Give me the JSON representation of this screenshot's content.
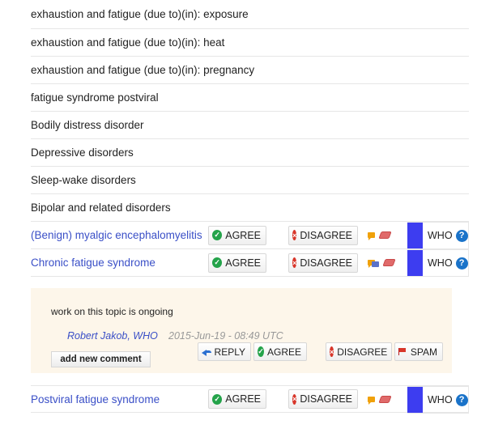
{
  "items": [
    {
      "label": "exhaustion and fatigue (due to)(in): exposure"
    },
    {
      "label": "exhaustion and fatigue (due to)(in): heat"
    },
    {
      "label": "exhaustion and fatigue (due to)(in): pregnancy"
    },
    {
      "label": "fatigue syndrome postviral"
    },
    {
      "label": "Bodily distress disorder"
    },
    {
      "label": "Depressive disorders"
    },
    {
      "label": "Sleep-wake disorders"
    },
    {
      "label": "Bipolar and related disorders"
    }
  ],
  "proposals": [
    {
      "label": "(Benign) myalgic encephalomyelitis",
      "agree": "AGREE",
      "disagree": "DISAGREE",
      "who": "WHO"
    },
    {
      "label": "Chronic fatigue syndrome",
      "agree": "AGREE",
      "disagree": "DISAGREE",
      "who": "WHO"
    },
    {
      "label": "Postviral fatigue syndrome",
      "agree": "AGREE",
      "disagree": "DISAGREE",
      "who": "WHO"
    }
  ],
  "comment": {
    "text": "work on this topic is ongoing",
    "author": "Robert Jakob, WHO",
    "date": "2015-Jun-19 - 08:49 UTC",
    "add_label": "add new comment",
    "reply": "REPLY",
    "agree": "AGREE",
    "disagree": "DISAGREE",
    "spam": "SPAM"
  },
  "icons": {
    "agree": "check-icon",
    "disagree": "x-icon",
    "comment": "comment-icon",
    "book": "book-icon",
    "help": "question-icon",
    "reply": "reply-arrow-icon",
    "spam": "flag-icon"
  },
  "colors": {
    "link": "#3a4fc7",
    "who_bar": "#3d3df0",
    "comment_bg": "#fdf6ea",
    "agree": "#24a34a",
    "disagree": "#d8362a"
  }
}
